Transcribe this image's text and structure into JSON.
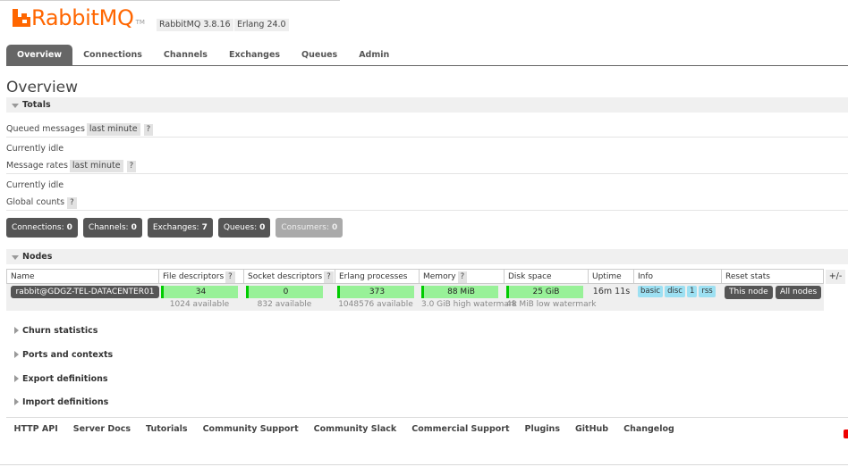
{
  "header": {
    "logo_text": "RabbitMQ",
    "logo_tm": "TM",
    "version": "RabbitMQ 3.8.16",
    "erlang": "Erlang 24.0"
  },
  "tabs": [
    {
      "label": "Overview",
      "active": true
    },
    {
      "label": "Connections"
    },
    {
      "label": "Channels"
    },
    {
      "label": "Exchanges"
    },
    {
      "label": "Queues"
    },
    {
      "label": "Admin"
    }
  ],
  "page_title": "Overview",
  "totals": {
    "heading": "Totals",
    "queued_label": "Queued messages",
    "queued_range": "last minute",
    "help": "?",
    "queued_status": "Currently idle",
    "rates_label": "Message rates",
    "rates_range": "last minute",
    "rates_status": "Currently idle",
    "global_label": "Global counts"
  },
  "counts": {
    "connections_label": "Connections:",
    "connections": "0",
    "channels_label": "Channels:",
    "channels": "0",
    "exchanges_label": "Exchanges:",
    "exchanges": "7",
    "queues_label": "Queues:",
    "queues": "0",
    "consumers_label": "Consumers:",
    "consumers": "0"
  },
  "nodes": {
    "heading": "Nodes",
    "columns": [
      "Name",
      "File descriptors",
      "Socket descriptors",
      "Erlang processes",
      "Memory",
      "Disk space",
      "Uptime",
      "Info",
      "Reset stats"
    ],
    "plus_minus": "+/-",
    "row": {
      "name": "rabbit@GDGZ-TEL-DATACENTER01",
      "file_descriptors": "34",
      "file_descriptors_avail": "1024 available",
      "socket_descriptors": "0",
      "socket_descriptors_avail": "832 available",
      "erlang_processes": "373",
      "erlang_processes_avail": "1048576 available",
      "memory": "88 MiB",
      "memory_watermark": "3.0 GiB high watermark",
      "disk_space": "25 GiB",
      "disk_watermark": "48 MiB low watermark",
      "uptime": "16m 11s",
      "info_tags": [
        "basic",
        "disc",
        "1",
        "rss"
      ],
      "reset_this": "This node",
      "reset_all": "All nodes"
    }
  },
  "collapsed_sections": [
    "Churn statistics",
    "Ports and contexts",
    "Export definitions",
    "Import definitions"
  ],
  "footer_links": [
    "HTTP API",
    "Server Docs",
    "Tutorials",
    "Community Support",
    "Community Slack",
    "Commercial Support",
    "Plugins",
    "GitHub",
    "Changelog"
  ],
  "colors": {
    "brand": "#ff6600",
    "tab_active": "#666666",
    "count_badge": "#555555",
    "count_badge_dim": "#aaaaaa",
    "green_bar": "#98f198",
    "info_tag": "#9de0f2"
  }
}
